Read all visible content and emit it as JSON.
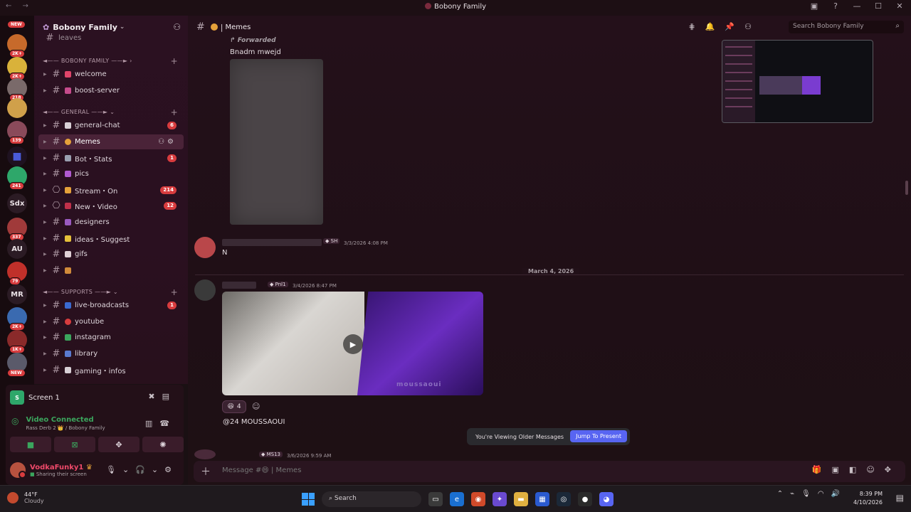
{
  "window": {
    "title": "Bobony Family",
    "controls": [
      "minimize",
      "maximize",
      "close"
    ]
  },
  "rail": {
    "servers": [
      {
        "label": "NEW",
        "kind": "new-pill"
      },
      {
        "label": "",
        "badge": "2K+",
        "color": "#c76a2b"
      },
      {
        "label": "",
        "badge": "2K+",
        "color": "#d9b23a"
      },
      {
        "label": "",
        "badge": "218",
        "color": "#7a6a6a"
      },
      {
        "label": "",
        "badge": "",
        "color": "#d0a04a"
      },
      {
        "label": "",
        "badge": "139",
        "color": "#8a4a5a"
      },
      {
        "label": "",
        "badge": "",
        "color": "#4a5bd8"
      },
      {
        "label": "",
        "badge": "241",
        "color": "#2ea76a"
      },
      {
        "label": "Sdx",
        "badge": "",
        "color": "#2b1b24"
      },
      {
        "label": "",
        "badge": "337",
        "color": "#a03a3a"
      },
      {
        "label": "AU",
        "badge": "",
        "color": "#2b1b24"
      },
      {
        "label": "",
        "badge": "79",
        "color": "#c0302a"
      },
      {
        "label": "MR",
        "badge": "",
        "color": "#2b1b24"
      },
      {
        "label": "",
        "badge": "2K+",
        "color": "#3a6ab0"
      },
      {
        "label": "",
        "badge": "1K+",
        "color": "#8a2a2a"
      },
      {
        "label": "",
        "badge": "",
        "color": "#5a5a6a"
      },
      {
        "label": "NEW",
        "kind": "new-pill"
      }
    ]
  },
  "server": {
    "name": "Bobony Family",
    "categories": [
      {
        "label": "BOBONY FAMILY",
        "channels": [
          {
            "name": "welcome",
            "emoji_color": "#e0456a"
          },
          {
            "name": "boost-server",
            "emoji_color": "#c64b8c"
          }
        ]
      },
      {
        "label": "GENERAL",
        "channels": [
          {
            "name": "general-chat",
            "emoji_color": "#d8d0d6",
            "unread": "6"
          },
          {
            "name": "Memes",
            "emoji_color": "#e5a13a",
            "active": true
          },
          {
            "name": "Bot・Stats",
            "emoji_color": "#9aa0b0",
            "unread": "1"
          },
          {
            "name": "pics",
            "emoji_color": "#b05ad0"
          },
          {
            "name": "Stream・On",
            "emoji_color": "#e5a13a",
            "unread": "214"
          },
          {
            "name": "New・Video",
            "emoji_color": "#c0304a",
            "unread": "12"
          },
          {
            "name": "designers",
            "emoji_color": "#9a5ac0"
          },
          {
            "name": "ideas・Suggest",
            "emoji_color": "#e5c03a"
          },
          {
            "name": "gifs",
            "emoji_color": "#e0d0d6"
          },
          {
            "name": "",
            "emoji_color": "#d08a3a"
          }
        ]
      },
      {
        "label": "SUPPORTS",
        "channels": [
          {
            "name": "live-broadcasts",
            "emoji_color": "#3a6ad0",
            "unread": "1"
          },
          {
            "name": "youtube",
            "emoji_color": "#d83c3e"
          },
          {
            "name": "instagram",
            "emoji_color": "#3ba55d"
          },
          {
            "name": "library",
            "emoji_color": "#5a7ad0"
          },
          {
            "name": "gaming・infos",
            "emoji_color": "#d8d0d6"
          }
        ]
      }
    ],
    "truncated_top_channel": "leaves"
  },
  "voice_panel": {
    "screen_label": "Screen 1",
    "status": "Video Connected",
    "location": "Rass Derb 2 👑 / Bobony Family",
    "user_name": "VodkaFunky1",
    "user_status": "Sharing their screen"
  },
  "channel": {
    "name": "Memes"
  },
  "messages": {
    "forwarded_label": "Forwarded",
    "forwarded_text": "Bnadm mwejd",
    "msg2_tag": "SH",
    "msg2_time": "3/3/2026 4:08 PM",
    "msg2_text": "N",
    "date_divider": "March 4, 2026",
    "msg3_tag": "Pnl1",
    "msg3_time": "3/4/2026 8:47 PM",
    "video_caption": "moussaoui",
    "reaction_count": "4",
    "msg3_text": "@24 MOUSSAOUI",
    "msg4_tag": "MS13",
    "msg4_time": "3/6/2026 9:59 AM"
  },
  "older_bar": {
    "text": "You're Viewing Older Messages",
    "button": "Jump To Present"
  },
  "search": {
    "placeholder": "Search Bobony Family"
  },
  "composer": {
    "placeholder": "Message #😄 | Memes"
  },
  "taskbar": {
    "weather_temp": "44°F",
    "weather_desc": "Cloudy",
    "search_label": "Search",
    "time": "8:39 PM",
    "date": "4/10/2026"
  }
}
